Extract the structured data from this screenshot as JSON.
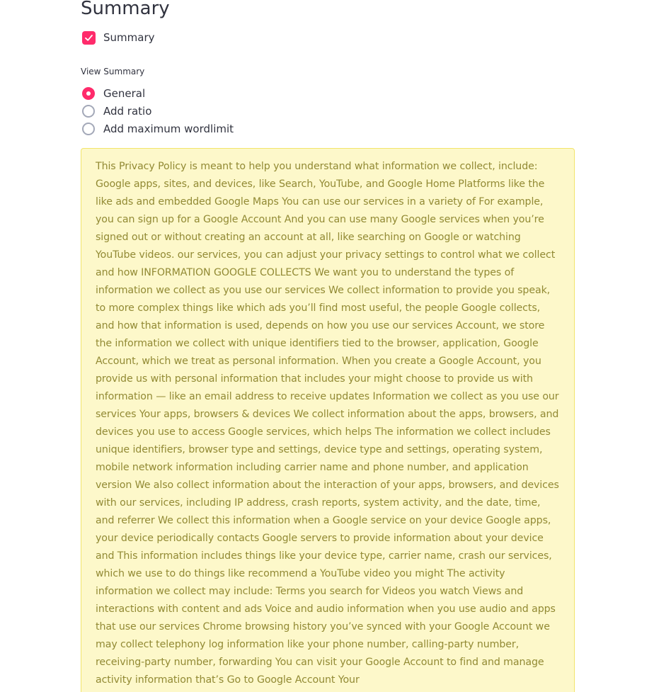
{
  "header": {
    "title": "Summary"
  },
  "summary_toggle": {
    "label": "Summary",
    "checked": true
  },
  "view_summary": {
    "label": "View Summary",
    "options": [
      {
        "label": "General",
        "selected": true
      },
      {
        "label": "Add ratio",
        "selected": false
      },
      {
        "label": "Add maximum wordlimit",
        "selected": false
      }
    ]
  },
  "summary_output": {
    "text": "This Privacy Policy is meant to help you understand what information we collect, include: Google apps, sites, and devices, like Search, YouTube, and Google Home Platforms like the like ads and embedded Google Maps You can use our services in a variety of For example, you can sign up for a Google Account And you can use many Google services when you’re signed out or without creating an account at all, like searching on Google or watching YouTube videos. our services, you can adjust your privacy settings to control what we collect and how INFORMATION GOOGLE COLLECTS We want you to understand the types of information we collect as you use our services We collect information to provide you speak, to more complex things like which ads you’ll find most useful, the people Google collects, and how that information is used, depends on how you use our services Account, we store the information we collect with unique identifiers tied to the browser, application, Google Account, which we treat as personal information. When you create a Google Account, you provide us with personal information that includes your might choose to provide us with information — like an email address to receive updates Information we collect as you use our services Your apps, browsers & devices We collect information about the apps, browsers, and devices you use to access Google services, which helps The information we collect includes unique identifiers, browser type and settings, device type and settings, operating system, mobile network information including carrier name and phone number, and application version We also collect information about the interaction of your apps, browsers, and devices with our services, including IP address, crash reports, system activity, and the date, time, and referrer We collect this information when a Google service on your device Google apps, your device periodically contacts Google servers to provide information about your device and This information includes things like your device type, carrier name, crash our services, which we use to do things like recommend a YouTube video you might The activity information we collect may include: Terms you search for Videos you watch Views and interactions with content and ads Voice and audio information when you use audio and apps that use our services Chrome browsing history you’ve synced with your Google Account we may collect telephony log information like your phone number, calling-party number, receiving-party number, forwarding You can visit your Google Account to find and manage activity information that’s Go to Google Account Your"
  },
  "colors": {
    "accent": "#ff2b6b",
    "summary_background": "#fdf8ca",
    "summary_border": "#f2e46a",
    "summary_text": "#928a34",
    "text": "#31333f"
  }
}
